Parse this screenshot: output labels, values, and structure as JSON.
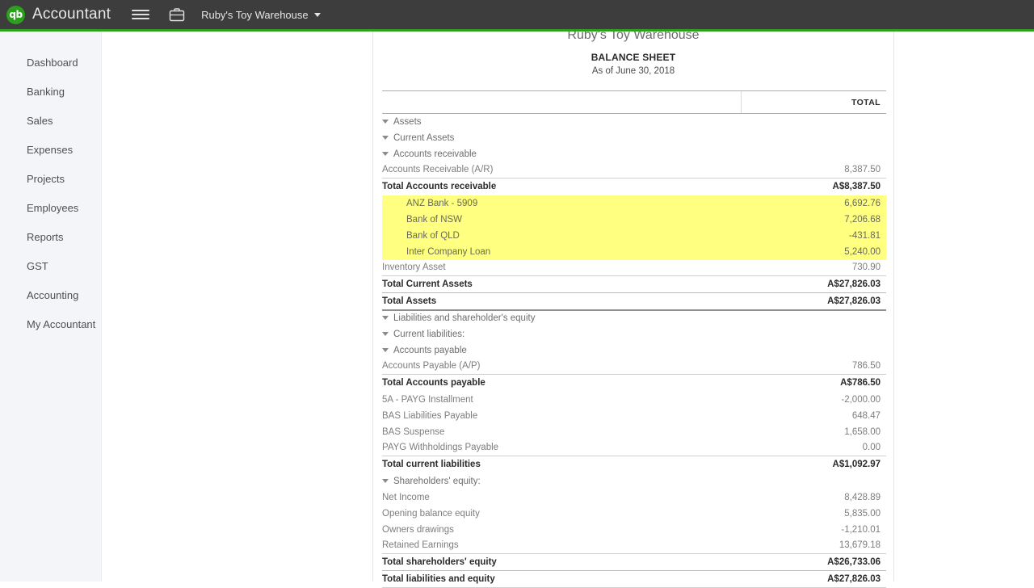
{
  "topbar": {
    "logo_text": "qb",
    "wordmark": "Accountant",
    "menu_icon": "hamburger-menu-icon",
    "briefcase_icon": "briefcase-icon",
    "company_name": "Ruby's Toy Warehouse",
    "bar_color": "#3d3d3d",
    "accent_color": "#2ca01c"
  },
  "sidebar": {
    "items": [
      {
        "label": "Dashboard"
      },
      {
        "label": "Banking"
      },
      {
        "label": "Sales"
      },
      {
        "label": "Expenses"
      },
      {
        "label": "Projects"
      },
      {
        "label": "Employees"
      },
      {
        "label": "Reports"
      },
      {
        "label": "GST"
      },
      {
        "label": "Accounting"
      },
      {
        "label": "My Accountant"
      }
    ]
  },
  "report": {
    "company": "Ruby's Toy Warehouse",
    "title": "BALANCE SHEET",
    "subtitle": "As of June 30, 2018",
    "columns": {
      "label": "",
      "total": "TOTAL"
    },
    "highlight_color": "#ffff80",
    "rows": [
      {
        "label": "Assets",
        "amount": "",
        "depth": 0,
        "kind": "section"
      },
      {
        "label": "Current Assets",
        "amount": "",
        "depth": 1,
        "kind": "section"
      },
      {
        "label": "Accounts receivable",
        "amount": "",
        "depth": 2,
        "kind": "section"
      },
      {
        "label": "Accounts Receivable (A/R)",
        "amount": "8,387.50",
        "depth": 3,
        "kind": "row"
      },
      {
        "label": "Total Accounts receivable",
        "amount": "A$8,387.50",
        "depth": 2,
        "kind": "total"
      },
      {
        "label": "ANZ Bank - 5909",
        "amount": "6,692.76",
        "depth": 3,
        "kind": "row",
        "highlight": true
      },
      {
        "label": "Bank of NSW",
        "amount": "7,206.68",
        "depth": 3,
        "kind": "row",
        "highlight": true
      },
      {
        "label": "Bank of QLD",
        "amount": "-431.81",
        "depth": 3,
        "kind": "row",
        "highlight": true
      },
      {
        "label": "Inter Company Loan",
        "amount": "5,240.00",
        "depth": 3,
        "kind": "row",
        "highlight": true
      },
      {
        "label": "Inventory Asset",
        "amount": "730.90",
        "depth": 3,
        "kind": "row"
      },
      {
        "label": "Total Current Assets",
        "amount": "A$27,826.03",
        "depth": 1,
        "kind": "total"
      },
      {
        "label": "Total Assets",
        "amount": "A$27,826.03",
        "depth": 0,
        "kind": "grandtotal"
      },
      {
        "label": "Liabilities and shareholder's equity",
        "amount": "",
        "depth": 0,
        "kind": "section"
      },
      {
        "label": "Current liabilities:",
        "amount": "",
        "depth": 1,
        "kind": "section"
      },
      {
        "label": "Accounts payable",
        "amount": "",
        "depth": 2,
        "kind": "section"
      },
      {
        "label": "Accounts Payable (A/P)",
        "amount": "786.50",
        "depth": 3,
        "kind": "row"
      },
      {
        "label": "Total Accounts payable",
        "amount": "A$786.50",
        "depth": 2,
        "kind": "total"
      },
      {
        "label": "5A - PAYG Installment",
        "amount": "-2,000.00",
        "depth": 3,
        "kind": "row"
      },
      {
        "label": "BAS Liabilities Payable",
        "amount": "648.47",
        "depth": 3,
        "kind": "row"
      },
      {
        "label": "BAS Suspense",
        "amount": "1,658.00",
        "depth": 3,
        "kind": "row"
      },
      {
        "label": "PAYG Withholdings Payable",
        "amount": "0.00",
        "depth": 3,
        "kind": "row"
      },
      {
        "label": "Total current liabilities",
        "amount": "A$1,092.97",
        "depth": 2,
        "kind": "total"
      },
      {
        "label": "Shareholders' equity:",
        "amount": "",
        "depth": 1,
        "kind": "section"
      },
      {
        "label": "Net Income",
        "amount": "8,428.89",
        "depth": 3,
        "kind": "row"
      },
      {
        "label": "Opening balance equity",
        "amount": "5,835.00",
        "depth": 3,
        "kind": "row"
      },
      {
        "label": "Owners drawings",
        "amount": "-1,210.01",
        "depth": 3,
        "kind": "row"
      },
      {
        "label": "Retained Earnings",
        "amount": "13,679.18",
        "depth": 3,
        "kind": "row"
      },
      {
        "label": "Total shareholders' equity",
        "amount": "A$26,733.06",
        "depth": 2,
        "kind": "total"
      },
      {
        "label": "Total liabilities and equity",
        "amount": "A$27,826.03",
        "depth": 0,
        "kind": "finaltotal"
      }
    ]
  }
}
